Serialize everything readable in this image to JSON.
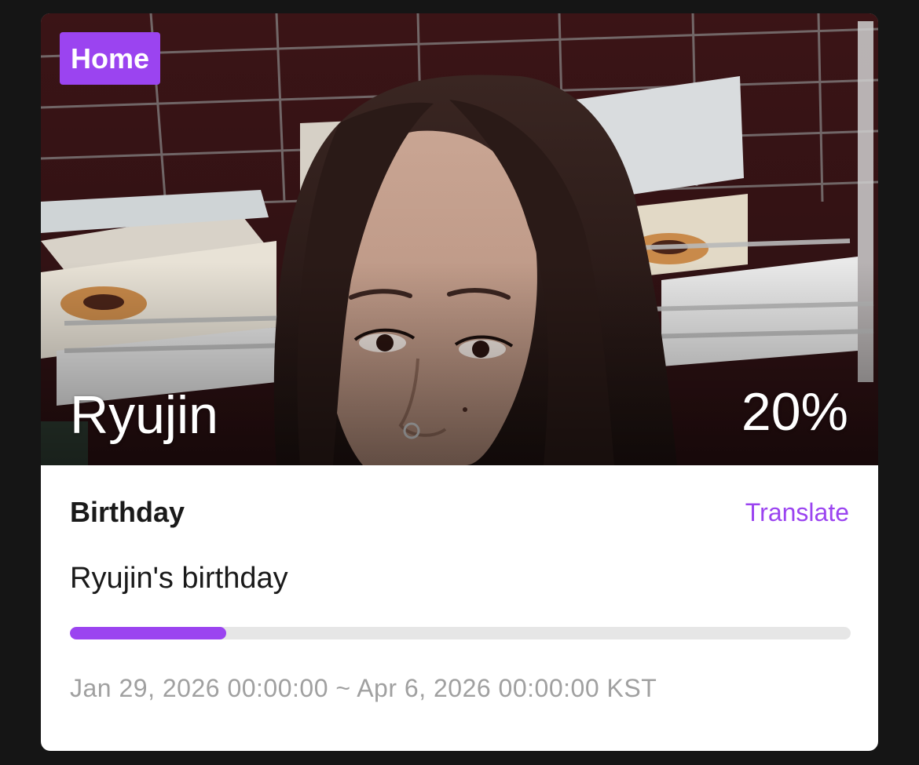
{
  "hero": {
    "badge_label": "Home",
    "name": "Ryujin",
    "percent_label": "20%"
  },
  "event": {
    "type": "Birthday",
    "translate_label": "Translate",
    "description": "Ryujin's birthday",
    "progress_fraction": 0.2,
    "period": "Jan 29, 2026 00:00:00 ~ Apr 6, 2026 00:00:00 KST"
  },
  "colors": {
    "accent": "#9b44f0",
    "track": "#e6e6e6",
    "muted_text": "#a0a0a0",
    "page_background": "#151515"
  }
}
